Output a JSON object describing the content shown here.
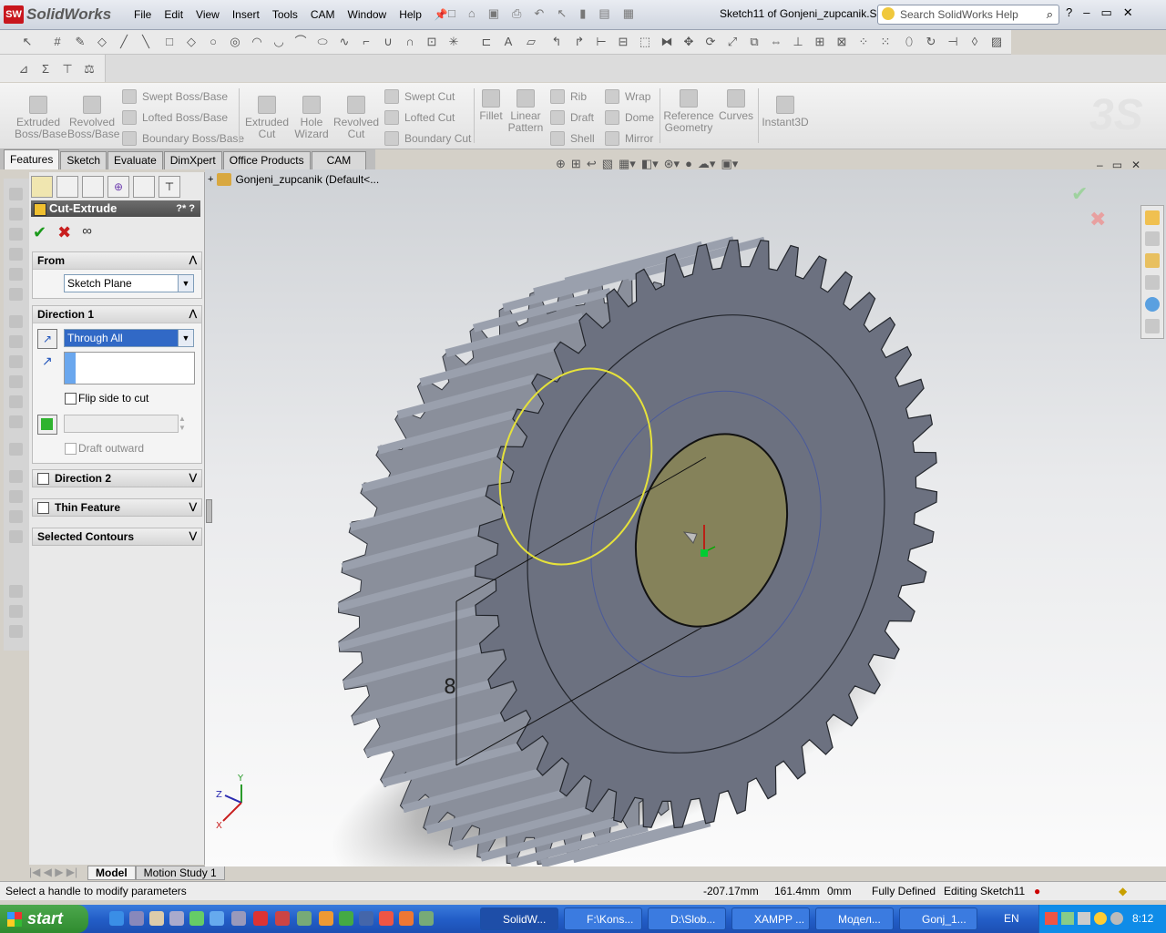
{
  "app": {
    "name": "SolidWorks",
    "logo_mark": "SW",
    "doc_title": "Sketch11 of Gonjeni_zupcanik.S..."
  },
  "menu": [
    "File",
    "Edit",
    "View",
    "Insert",
    "Tools",
    "CAM",
    "Window",
    "Help"
  ],
  "search": {
    "placeholder": "Search SolidWorks Help"
  },
  "command_manager": {
    "extrude_boss": "Extruded\nBoss/Base",
    "revolve_boss": "Revolved\nBoss/Base",
    "swept_boss": "Swept Boss/Base",
    "lofted_boss": "Lofted Boss/Base",
    "boundary_boss": "Boundary Boss/Base",
    "extruded_cut": "Extruded\nCut",
    "hole_wizard": "Hole\nWizard",
    "revolved_cut": "Revolved\nCut",
    "swept_cut": "Swept Cut",
    "lofted_cut": "Lofted Cut",
    "boundary_cut": "Boundary Cut",
    "fillet": "Fillet",
    "linear_pattern": "Linear\nPattern",
    "rib": "Rib",
    "draft": "Draft",
    "shell": "Shell",
    "wrap": "Wrap",
    "dome": "Dome",
    "mirror": "Mirror",
    "ref_geom": "Reference\nGeometry",
    "curves": "Curves",
    "instant3d": "Instant3D"
  },
  "tabs": [
    "Features",
    "Sketch",
    "Evaluate",
    "DimXpert",
    "Office Products",
    "CAM"
  ],
  "property_manager": {
    "title": "Cut-Extrude",
    "from_label": "From",
    "from_value": "Sketch Plane",
    "dir1_label": "Direction 1",
    "dir1_value": "Through All",
    "flip_label": "Flip side to cut",
    "draft_label": "Draft outward",
    "dir2_label": "Direction 2",
    "thin_label": "Thin Feature",
    "contours_label": "Selected Contours"
  },
  "tree": {
    "root": "Gonjeni_zupcanik  (Default<..."
  },
  "bottom_tabs": [
    "Model",
    "Motion Study 1"
  ],
  "status": {
    "message": "Select a handle to modify parameters",
    "x": "-207.17mm",
    "y": "161.4mm",
    "z": "0mm",
    "state": "Fully Defined",
    "editing": "Editing Sketch11"
  },
  "taskbar": {
    "start": "start",
    "buttons": [
      "SolidW...",
      "F:\\Kons...",
      "D:\\Slob...",
      "XAMPP ...",
      "Модел...",
      "Gonj_1..."
    ],
    "lang": "EN",
    "clock": "8:12"
  },
  "gear": {
    "teeth": 46,
    "body_color": "#6c7180",
    "hub_color": "#85825a"
  }
}
